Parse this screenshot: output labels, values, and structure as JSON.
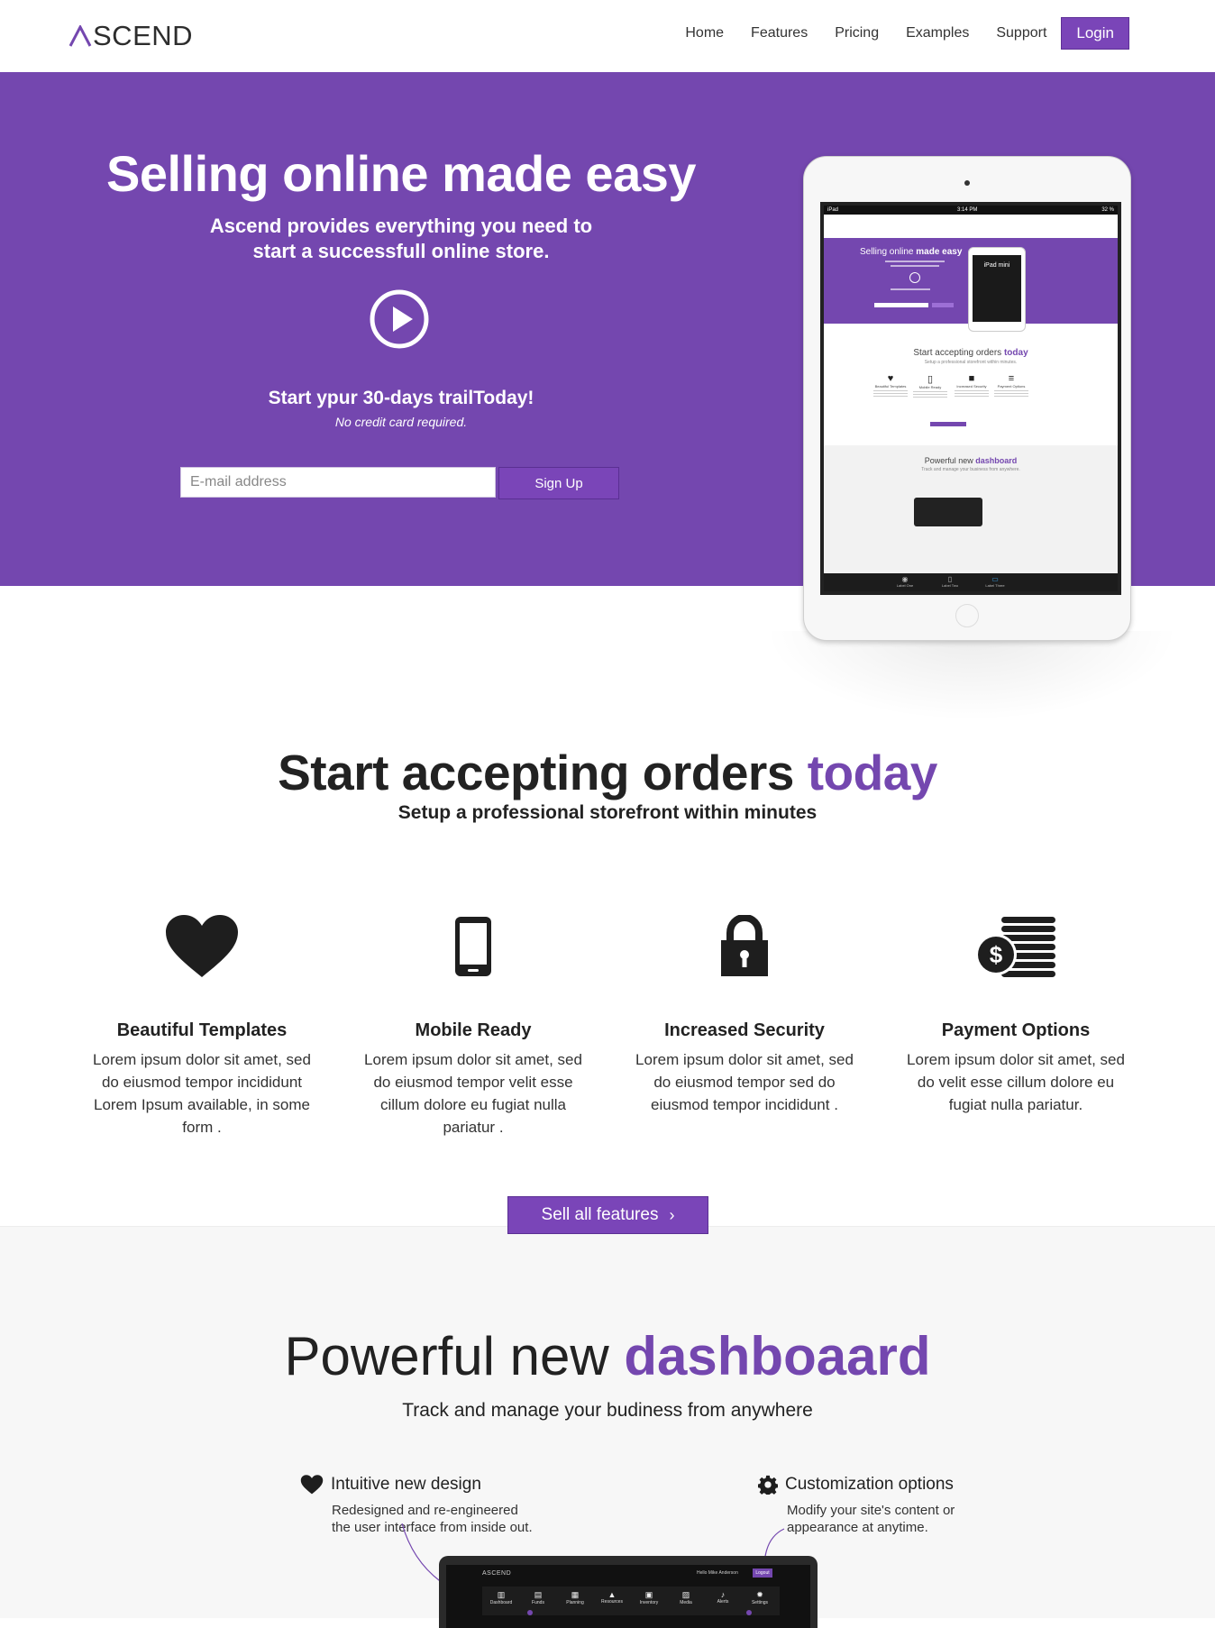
{
  "header": {
    "logo_text": "SCEND",
    "nav": [
      "Home",
      "Features",
      "Pricing",
      "Examples",
      "Support"
    ],
    "login_label": "Login"
  },
  "hero": {
    "title": "Selling online made easy",
    "subtitle_line1": "Ascend provides everything you need to",
    "subtitle_line2": "start a successfull online store.",
    "trial_title": "Start ypur 30-days trailToday!",
    "trial_note": "No credit card required.",
    "email_placeholder": "E-mail address",
    "signup_label": "Sign Up"
  },
  "ipad_preview": {
    "status_left": "iPad",
    "status_time": "3:14 PM",
    "status_right": "32 %",
    "hero_title_plain": "Selling online ",
    "hero_title_bold": "made easy",
    "inner_device_label": "iPad mini",
    "section_title_plain": "Start accepting orders ",
    "section_title_accent": "today",
    "section_sub": "Setup a professional storefront within minutes.",
    "features": [
      "Beautiful Templates",
      "Mobile Ready",
      "Increased Security",
      "Payment Options"
    ],
    "dash_title_plain": "Powerful new ",
    "dash_title_accent": "dashboard",
    "dash_sub": "Track and manage your business from anywhere.",
    "tabs": [
      "Label One",
      "Label Two",
      "Label Three"
    ]
  },
  "orders": {
    "title_plain": "Start accepting orders ",
    "title_accent": "today",
    "subtitle": "Setup a professional storefront within minutes",
    "features": [
      {
        "name": "Beautiful Templates",
        "icon": "heart-icon",
        "desc": "Lorem ipsum dolor sit amet, sed do eiusmod tempor incididunt Lorem Ipsum available, in some form ."
      },
      {
        "name": "Mobile Ready",
        "icon": "mobile-icon",
        "desc": "Lorem ipsum dolor sit amet, sed do eiusmod tempor velit esse cillum dolore eu fugiat nulla pariatur ."
      },
      {
        "name": "Increased Security",
        "icon": "lock-icon",
        "desc": "Lorem ipsum dolor sit amet, sed do eiusmod tempor sed do eiusmod tempor incididunt ."
      },
      {
        "name": "Payment Options",
        "icon": "coins-icon",
        "desc": "Lorem ipsum dolor sit amet, sed do velit esse cillum dolore eu fugiat nulla pariatur."
      }
    ],
    "cta_label": "Sell all features"
  },
  "dashboard": {
    "title_plain": "Powerful new ",
    "title_accent": "dashboaard",
    "subtitle": "Track and manage your budiness from anywhere",
    "callouts": [
      {
        "title": "Intuitive new design",
        "icon": "heart-icon",
        "desc_line1": "Redesigned and re-engineered",
        "desc_line2": "the user interface from inside out."
      },
      {
        "title": "Customization options",
        "icon": "gear-icon",
        "desc_line1": "Modify your site's content or",
        "desc_line2": "appearance at anytime."
      }
    ],
    "laptop": {
      "logo": "ASCEND",
      "user": "Hello Mike Anderson",
      "logout": "Logout",
      "nav": [
        "Dashboard",
        "Funds",
        "Planning",
        "Resources",
        "Inventory",
        "Media",
        "Alerts",
        "Settings"
      ]
    }
  },
  "colors": {
    "accent": "#7447af",
    "button": "#7a45b8"
  }
}
